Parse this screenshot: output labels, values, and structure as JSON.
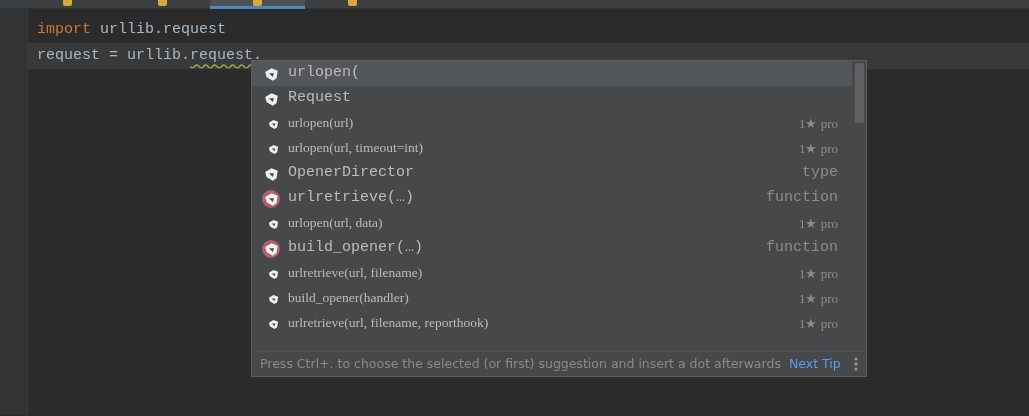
{
  "tabs": [
    {
      "selected": false
    },
    {
      "selected": false
    },
    {
      "selected": true
    },
    {
      "selected": false
    }
  ],
  "code_lines": [
    {
      "highlighted": false,
      "tokens": [
        {
          "kind": "keyword",
          "text": "import"
        },
        {
          "kind": "plain",
          "text": " urllib.request"
        }
      ]
    },
    {
      "highlighted": true,
      "tokens": [
        {
          "kind": "plain",
          "text": "request = urllib."
        },
        {
          "kind": "warning",
          "text": "request"
        },
        {
          "kind": "plain",
          "text": "."
        }
      ]
    }
  ],
  "completion": {
    "items": [
      {
        "kind": "large",
        "selected": true,
        "badge": false,
        "label": "urlopen("
      },
      {
        "kind": "large",
        "selected": false,
        "badge": false,
        "label": "Request"
      },
      {
        "kind": "small",
        "selected": false,
        "badge": false,
        "label": "urlopen(url)",
        "detail": "1★ pro"
      },
      {
        "kind": "small",
        "selected": false,
        "badge": false,
        "label": "urlopen(url, timeout=int)",
        "detail": "1★ pro"
      },
      {
        "kind": "large",
        "selected": false,
        "badge": false,
        "label": "OpenerDirector",
        "detail": "type"
      },
      {
        "kind": "large",
        "selected": false,
        "badge": true,
        "label": "urlretrieve(…)",
        "detail": "function"
      },
      {
        "kind": "small",
        "selected": false,
        "badge": false,
        "label": "urlopen(url, data)",
        "detail": "1★ pro"
      },
      {
        "kind": "large",
        "selected": false,
        "badge": true,
        "label": "build_opener(…)",
        "detail": "function"
      },
      {
        "kind": "small",
        "selected": false,
        "badge": false,
        "label": "urlretrieve(url, filename)",
        "detail": "1★ pro"
      },
      {
        "kind": "small",
        "selected": false,
        "badge": false,
        "label": "build_opener(handler)",
        "detail": "1★ pro"
      },
      {
        "kind": "small",
        "selected": false,
        "badge": false,
        "label": "urlretrieve(url, filename, reporthook)",
        "detail": "1★ pro"
      }
    ],
    "hint": "Press Ctrl+. to choose the selected (or first) suggestion and insert a dot afterwards",
    "link": "Next Tip"
  }
}
